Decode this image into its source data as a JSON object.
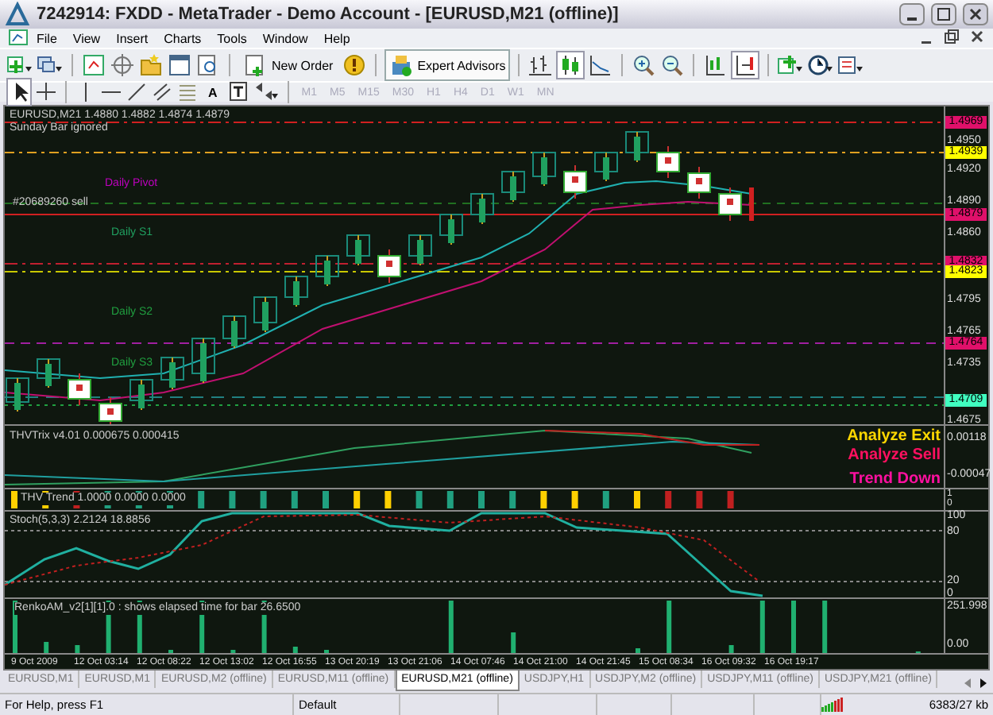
{
  "window": {
    "title": "7242914: FXDD - MetaTrader - Demo Account - [EURUSD,M21 (offline)]"
  },
  "menu": [
    "File",
    "View",
    "Insert",
    "Charts",
    "Tools",
    "Window",
    "Help"
  ],
  "toolbar": {
    "new_order": "New Order",
    "text_tool": "A",
    "expert_advisors": {
      "label": "Expert Advisors",
      "on": true
    }
  },
  "timeframes": [
    {
      "label": "M1",
      "disabled": true
    },
    {
      "label": "M5",
      "disabled": true
    },
    {
      "label": "M15",
      "disabled": true
    },
    {
      "label": "M30",
      "disabled": true
    },
    {
      "label": "H1",
      "disabled": true
    },
    {
      "label": "H4",
      "disabled": true
    },
    {
      "label": "D1",
      "disabled": true
    },
    {
      "label": "W1",
      "disabled": true
    },
    {
      "label": "MN",
      "disabled": true
    }
  ],
  "chart": {
    "header": "EURUSD,M21  1.4880 1.4882 1.4874 1.4879",
    "note": "Sunday Bar ignored",
    "labels": [
      {
        "text": "Daily Pivot",
        "color": "#c000c0"
      },
      {
        "text": "#20689260 sell",
        "color": "#c8c8c8"
      },
      {
        "text": "Daily S1",
        "color": "#20a060"
      },
      {
        "text": "Daily S2",
        "color": "#20a040"
      },
      {
        "text": "Daily S3",
        "color": "#20a040"
      }
    ],
    "price_ticks": [
      "1.4950",
      "1.4920",
      "1.4890",
      "1.4860",
      "1.4795",
      "1.4765",
      "1.4735",
      "1.4675"
    ],
    "price_tags": [
      {
        "text": "1.4969",
        "color": "#e0106a"
      },
      {
        "text": "1.4939",
        "color": "#ffff00"
      },
      {
        "text": "1.4879",
        "color": "#e0106a"
      },
      {
        "text": "1.4832",
        "color": "#e0106a"
      },
      {
        "text": "1.4823",
        "color": "#ffff00"
      },
      {
        "text": "1.4764",
        "color": "#e0106a"
      },
      {
        "text": "1.4709",
        "color": "#40ffc0"
      }
    ]
  },
  "trix": {
    "label": "THVTrix v4.01 0.000675 0.000415",
    "signals": [
      {
        "text": "Analyze Exit",
        "color": "#ffd700"
      },
      {
        "text": "Analyze Sell",
        "color": "#ff1060"
      },
      {
        "text": "Trend Down",
        "color": "#ff10a0"
      }
    ],
    "ticks": [
      "0.00118",
      "-0.00047"
    ]
  },
  "trend": {
    "label": "THV Trend 1.0000 0.0000 0.0000",
    "ticks": [
      "1",
      "0"
    ]
  },
  "stoch": {
    "label": "Stoch(5,3,3) 2.2124 18.8856",
    "ticks": [
      "100",
      "80",
      "20",
      "0"
    ]
  },
  "renko": {
    "label": "RenkoAM_v2[1][1].0 : shows elapsed time for bar 26.6500",
    "ticks": [
      "251.998",
      "0.00"
    ]
  },
  "time_axis": [
    "9 Oct 2009",
    "12 Oct 03:14",
    "12 Oct 08:22",
    "12 Oct 13:02",
    "12 Oct 16:55",
    "13 Oct 20:19",
    "13 Oct 21:06",
    "14 Oct 07:46",
    "14 Oct 21:00",
    "14 Oct 21:45",
    "15 Oct 08:34",
    "16 Oct 09:32",
    "16 Oct 19:17"
  ],
  "tabs": [
    {
      "label": "EURUSD,M1",
      "selected": false
    },
    {
      "label": "EURUSD,M1",
      "selected": false
    },
    {
      "label": "EURUSD,M2 (offline)",
      "selected": false
    },
    {
      "label": "EURUSD,M11 (offline)",
      "selected": false
    },
    {
      "label": "EURUSD,M21 (offline)",
      "selected": true
    },
    {
      "label": "USDJPY,H1",
      "selected": false
    },
    {
      "label": "USDJPY,M2 (offline)",
      "selected": false
    },
    {
      "label": "USDJPY,M11 (offline)",
      "selected": false
    },
    {
      "label": "USDJPY,M21 (offline)",
      "selected": false
    }
  ],
  "status_bar": {
    "help": "For Help, press F1",
    "profile": "Default",
    "traffic": "6383/27 kb"
  }
}
